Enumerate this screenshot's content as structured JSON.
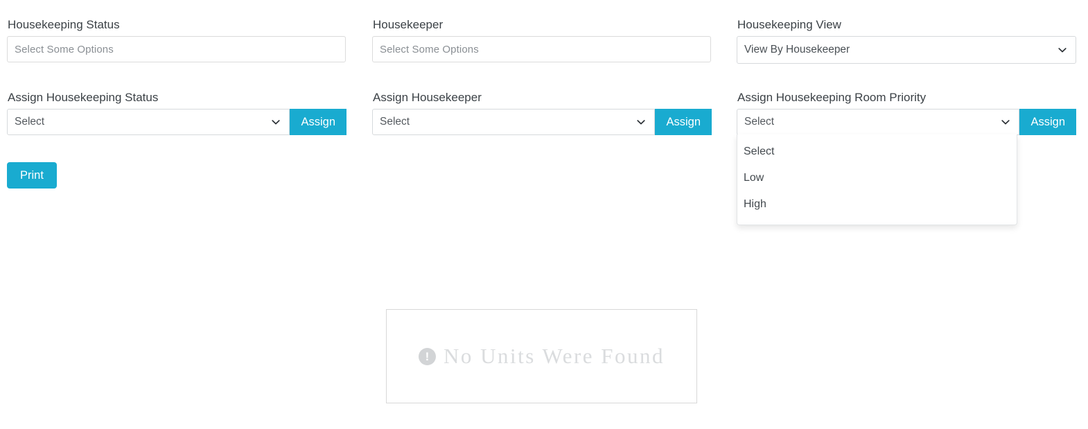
{
  "colors": {
    "accent": "#19abd0",
    "label_text": "#3b4146",
    "placeholder_text": "#8a8f94",
    "field_border": "#d6d9dc",
    "empty_text": "#dadcde",
    "empty_icon_bg": "#d2d4d6"
  },
  "filters": {
    "housekeeping_status": {
      "label": "Housekeeping Status",
      "placeholder": "Select Some Options",
      "value": ""
    },
    "housekeeper": {
      "label": "Housekeeper",
      "placeholder": "Select Some Options",
      "value": ""
    },
    "housekeeping_view": {
      "label": "Housekeeping View",
      "value": "View By Housekeeper",
      "chevron_icon": "chevron-down-icon"
    }
  },
  "assign": {
    "housekeeping_status": {
      "label": "Assign Housekeeping Status",
      "value": "Select",
      "button_label": "Assign",
      "chevron_icon": "chevron-down-icon"
    },
    "housekeeper": {
      "label": "Assign Housekeeper",
      "value": "Select",
      "button_label": "Assign",
      "chevron_icon": "chevron-down-icon"
    },
    "room_priority": {
      "label": "Assign Housekeeping Room Priority",
      "value": "Select",
      "button_label": "Assign",
      "chevron_icon": "chevron-down-icon",
      "open": true,
      "options": [
        {
          "label": "Select"
        },
        {
          "label": "Low"
        },
        {
          "label": "High"
        }
      ]
    }
  },
  "actions": {
    "print_label": "Print"
  },
  "empty_state": {
    "icon": "exclamation-circle-icon",
    "icon_glyph": "!",
    "message": "No Units Were Found"
  }
}
